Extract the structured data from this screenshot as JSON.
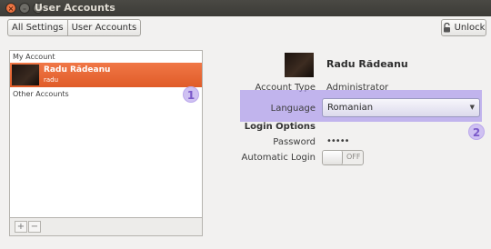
{
  "window": {
    "title": "User Accounts",
    "close_glyph": "×",
    "minimize_glyph": "–",
    "maximize_glyph": "□"
  },
  "toolbar": {
    "all_settings_label": "All Settings",
    "user_accounts_label": "User Accounts",
    "unlock_label": "Unlock"
  },
  "sidebar": {
    "my_account_header": "My Account",
    "selected_account": {
      "full_name": "Radu Rădeanu",
      "login": "radu"
    },
    "other_accounts_header": "Other Accounts",
    "add_glyph": "+",
    "remove_glyph": "−"
  },
  "details": {
    "full_name": "Radu Rădeanu",
    "account_type_label": "Account Type",
    "account_type_value": "Administrator",
    "language_label": "Language",
    "language_value": "Romanian",
    "login_options_header": "Login Options",
    "password_label": "Password",
    "password_value": "•••••",
    "automatic_login_label": "Automatic Login",
    "automatic_login_state": "OFF"
  },
  "annotations": {
    "marker_1": "1",
    "marker_2": "2"
  },
  "colors": {
    "selection": "#e86535",
    "highlight": "#a08ceb",
    "titlebar": "#3c3b37"
  }
}
